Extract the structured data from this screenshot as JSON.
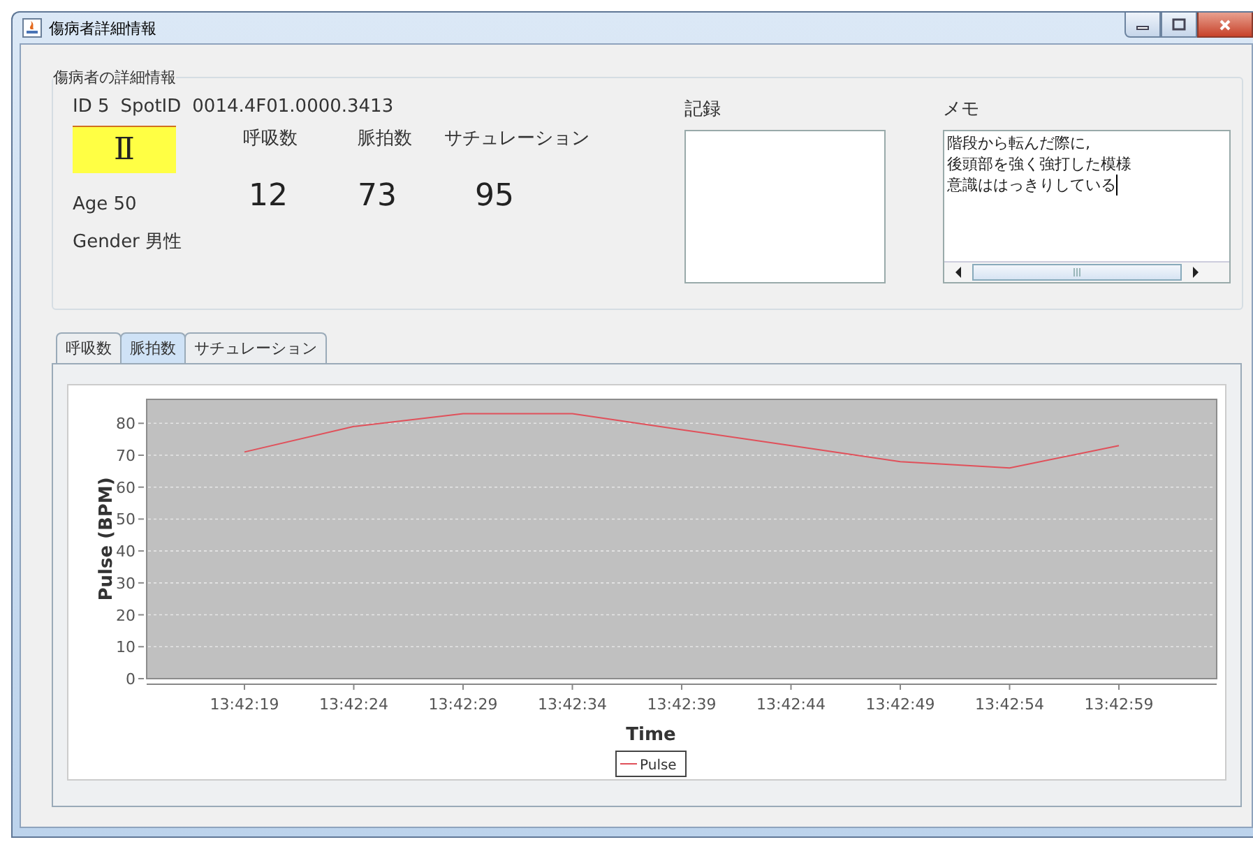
{
  "window": {
    "title": "傷病者詳細情報"
  },
  "details": {
    "group_title": "傷病者の詳細情報",
    "id_label": "ID 5",
    "spot_id_label": "SpotID",
    "spot_id": "0014.4F01.0000.3413",
    "triage": "Ⅱ",
    "age": "Age 50",
    "gender": "Gender 男性",
    "vitals": [
      {
        "label": "呼吸数",
        "value": "12"
      },
      {
        "label": "脈拍数",
        "value": "73"
      },
      {
        "label": "サチュレーション",
        "value": "95"
      }
    ],
    "record": {
      "label": "記録"
    },
    "memo": {
      "label": "メモ",
      "lines": [
        "階段から転んだ際に,",
        "後頭部を強く強打した模様",
        "意識ははっきりしている"
      ]
    }
  },
  "tabs": [
    {
      "label": "呼吸数",
      "selected": false
    },
    {
      "label": "脈拍数",
      "selected": true
    },
    {
      "label": "サチュレーション",
      "selected": false
    }
  ],
  "chart": {
    "chart_data": {
      "type": "line",
      "grid": true,
      "xlabel": "Time",
      "ylabel": "Pulse (BPM)",
      "categories": [
        "13:42:19",
        "13:42:24",
        "13:42:29",
        "13:42:34",
        "13:42:39",
        "13:42:44",
        "13:42:49",
        "13:42:54",
        "13:42:59"
      ],
      "series": [
        {
          "name": "Pulse",
          "color": "#e0505a",
          "values": [
            71,
            79,
            83,
            83,
            78,
            73,
            68,
            66,
            73
          ]
        }
      ],
      "ylim": [
        0,
        87.5
      ],
      "yticks": [
        0,
        10,
        20,
        30,
        40,
        50,
        60,
        70,
        80
      ]
    }
  }
}
